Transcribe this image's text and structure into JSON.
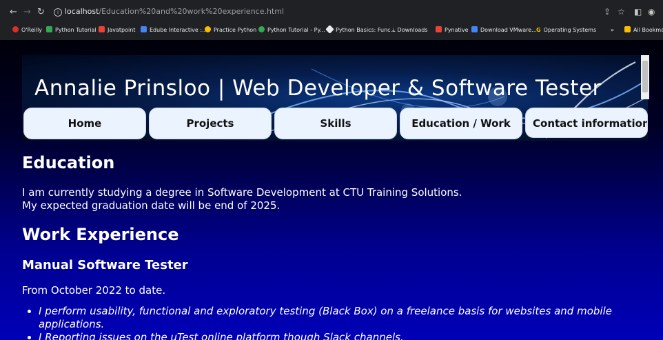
{
  "browser": {
    "url_host": "localhost",
    "url_path": "/Education%20and%20work%20experience.html",
    "bookmarks": [
      {
        "label": "O'Reilly",
        "color": "#d93025"
      },
      {
        "label": "Python Tutorial",
        "color": "#34a853"
      },
      {
        "label": "Javatpoint",
        "color": "#ea4335"
      },
      {
        "label": "Edube Interactive :...",
        "color": "#4285f4"
      },
      {
        "label": "Practice Python",
        "color": "#fbbc04"
      },
      {
        "label": "Python Tutorial - Py...",
        "color": "#34a853"
      },
      {
        "label": "Python Basics: Func...",
        "color": "#e8eaed"
      },
      {
        "label": "Downloads",
        "color": "#e8eaed"
      },
      {
        "label": "Pynative",
        "color": "#ea4335"
      },
      {
        "label": "Download VMware...",
        "color": "#4285f4"
      },
      {
        "label": "Operating Systems",
        "color": "#fbbc04"
      },
      {
        "label": "»",
        "color": "#202124"
      },
      {
        "label": "All Bookmarks",
        "color": "#fbbc04"
      }
    ]
  },
  "header": {
    "title": "Annalie Prinsloo | Web Developer & Software Tester"
  },
  "nav": {
    "items": [
      {
        "label": "Home"
      },
      {
        "label": "Projects"
      },
      {
        "label": "Skills"
      },
      {
        "label": "Education / Work"
      },
      {
        "label": "Contact information"
      }
    ]
  },
  "education": {
    "heading": "Education",
    "line1": "I am currently studying a degree in Software Development at CTU Training Solutions.",
    "line2": "My expected graduation date will be end of 2025."
  },
  "work": {
    "heading": "Work Experience",
    "role": "Manual Software Tester",
    "period": "From October 2022 to date.",
    "duties": [
      "I perform usability, functional and exploratory testing (Black Box) on a freelance basis for websites and mobile applications.",
      "I Reporting issues on the uTest online platform though Slack channels."
    ]
  },
  "colors": {
    "page_gradient_top": "#000000",
    "page_gradient_bottom": "#0000b8",
    "nav_button_bg": "#ebf3ff"
  }
}
